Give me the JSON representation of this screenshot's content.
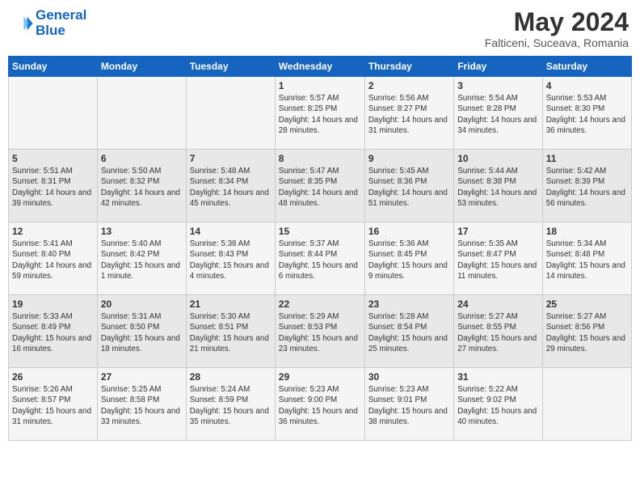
{
  "header": {
    "logo_line1": "General",
    "logo_line2": "Blue",
    "month_year": "May 2024",
    "location": "Falticeni, Suceava, Romania"
  },
  "days_of_week": [
    "Sunday",
    "Monday",
    "Tuesday",
    "Wednesday",
    "Thursday",
    "Friday",
    "Saturday"
  ],
  "weeks": [
    [
      {
        "day": "",
        "info": ""
      },
      {
        "day": "",
        "info": ""
      },
      {
        "day": "",
        "info": ""
      },
      {
        "day": "1",
        "info": "Sunrise: 5:57 AM\nSunset: 8:25 PM\nDaylight: 14 hours and 28 minutes."
      },
      {
        "day": "2",
        "info": "Sunrise: 5:56 AM\nSunset: 8:27 PM\nDaylight: 14 hours and 31 minutes."
      },
      {
        "day": "3",
        "info": "Sunrise: 5:54 AM\nSunset: 8:28 PM\nDaylight: 14 hours and 34 minutes."
      },
      {
        "day": "4",
        "info": "Sunrise: 5:53 AM\nSunset: 8:30 PM\nDaylight: 14 hours and 36 minutes."
      }
    ],
    [
      {
        "day": "5",
        "info": "Sunrise: 5:51 AM\nSunset: 8:31 PM\nDaylight: 14 hours and 39 minutes."
      },
      {
        "day": "6",
        "info": "Sunrise: 5:50 AM\nSunset: 8:32 PM\nDaylight: 14 hours and 42 minutes."
      },
      {
        "day": "7",
        "info": "Sunrise: 5:48 AM\nSunset: 8:34 PM\nDaylight: 14 hours and 45 minutes."
      },
      {
        "day": "8",
        "info": "Sunrise: 5:47 AM\nSunset: 8:35 PM\nDaylight: 14 hours and 48 minutes."
      },
      {
        "day": "9",
        "info": "Sunrise: 5:45 AM\nSunset: 8:36 PM\nDaylight: 14 hours and 51 minutes."
      },
      {
        "day": "10",
        "info": "Sunrise: 5:44 AM\nSunset: 8:38 PM\nDaylight: 14 hours and 53 minutes."
      },
      {
        "day": "11",
        "info": "Sunrise: 5:42 AM\nSunset: 8:39 PM\nDaylight: 14 hours and 56 minutes."
      }
    ],
    [
      {
        "day": "12",
        "info": "Sunrise: 5:41 AM\nSunset: 8:40 PM\nDaylight: 14 hours and 59 minutes."
      },
      {
        "day": "13",
        "info": "Sunrise: 5:40 AM\nSunset: 8:42 PM\nDaylight: 15 hours and 1 minute."
      },
      {
        "day": "14",
        "info": "Sunrise: 5:38 AM\nSunset: 8:43 PM\nDaylight: 15 hours and 4 minutes."
      },
      {
        "day": "15",
        "info": "Sunrise: 5:37 AM\nSunset: 8:44 PM\nDaylight: 15 hours and 6 minutes."
      },
      {
        "day": "16",
        "info": "Sunrise: 5:36 AM\nSunset: 8:45 PM\nDaylight: 15 hours and 9 minutes."
      },
      {
        "day": "17",
        "info": "Sunrise: 5:35 AM\nSunset: 8:47 PM\nDaylight: 15 hours and 11 minutes."
      },
      {
        "day": "18",
        "info": "Sunrise: 5:34 AM\nSunset: 8:48 PM\nDaylight: 15 hours and 14 minutes."
      }
    ],
    [
      {
        "day": "19",
        "info": "Sunrise: 5:33 AM\nSunset: 8:49 PM\nDaylight: 15 hours and 16 minutes."
      },
      {
        "day": "20",
        "info": "Sunrise: 5:31 AM\nSunset: 8:50 PM\nDaylight: 15 hours and 18 minutes."
      },
      {
        "day": "21",
        "info": "Sunrise: 5:30 AM\nSunset: 8:51 PM\nDaylight: 15 hours and 21 minutes."
      },
      {
        "day": "22",
        "info": "Sunrise: 5:29 AM\nSunset: 8:53 PM\nDaylight: 15 hours and 23 minutes."
      },
      {
        "day": "23",
        "info": "Sunrise: 5:28 AM\nSunset: 8:54 PM\nDaylight: 15 hours and 25 minutes."
      },
      {
        "day": "24",
        "info": "Sunrise: 5:27 AM\nSunset: 8:55 PM\nDaylight: 15 hours and 27 minutes."
      },
      {
        "day": "25",
        "info": "Sunrise: 5:27 AM\nSunset: 8:56 PM\nDaylight: 15 hours and 29 minutes."
      }
    ],
    [
      {
        "day": "26",
        "info": "Sunrise: 5:26 AM\nSunset: 8:57 PM\nDaylight: 15 hours and 31 minutes."
      },
      {
        "day": "27",
        "info": "Sunrise: 5:25 AM\nSunset: 8:58 PM\nDaylight: 15 hours and 33 minutes."
      },
      {
        "day": "28",
        "info": "Sunrise: 5:24 AM\nSunset: 8:59 PM\nDaylight: 15 hours and 35 minutes."
      },
      {
        "day": "29",
        "info": "Sunrise: 5:23 AM\nSunset: 9:00 PM\nDaylight: 15 hours and 36 minutes."
      },
      {
        "day": "30",
        "info": "Sunrise: 5:23 AM\nSunset: 9:01 PM\nDaylight: 15 hours and 38 minutes."
      },
      {
        "day": "31",
        "info": "Sunrise: 5:22 AM\nSunset: 9:02 PM\nDaylight: 15 hours and 40 minutes."
      },
      {
        "day": "",
        "info": ""
      }
    ]
  ]
}
